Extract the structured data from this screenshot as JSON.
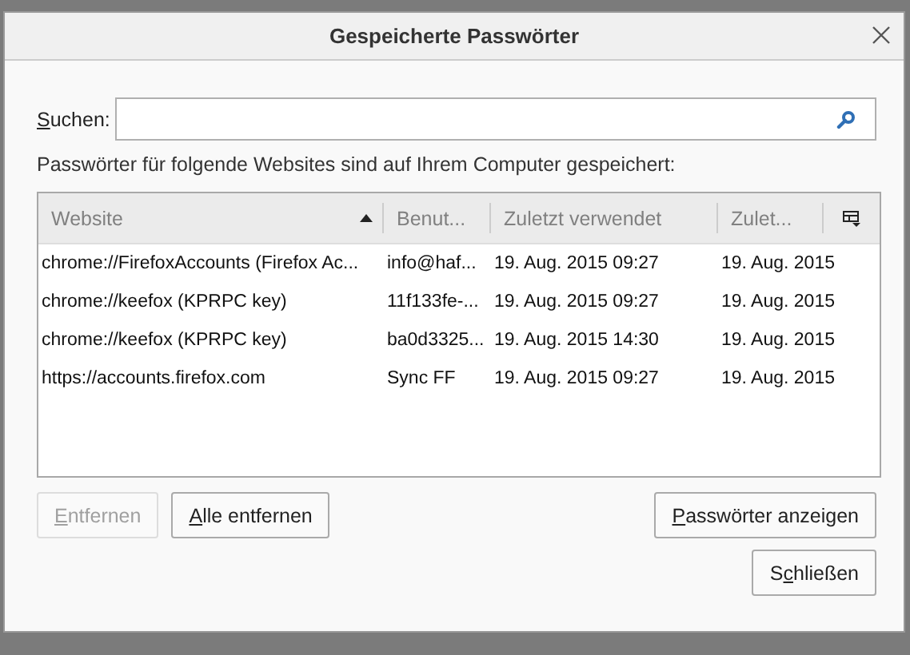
{
  "window": {
    "title": "Gespeicherte Passwörter"
  },
  "search": {
    "label": {
      "key": "S",
      "after": "uchen:"
    }
  },
  "description": "Passwörter für folgende Websites sind auf Ihrem Computer gespeichert:",
  "table": {
    "columns": [
      {
        "label": "Website",
        "sorted": true
      },
      {
        "label": "Benut...",
        "sorted": false
      },
      {
        "label": "Zuletzt verwendet",
        "sorted": false
      },
      {
        "label": "Zulet...",
        "sorted": false
      }
    ],
    "rows": [
      [
        "chrome://FirefoxAccounts (Firefox Ac...",
        "info@haf...",
        "19. Aug. 2015 09:27",
        "19. Aug. 2015"
      ],
      [
        "chrome://keefox (KPRPC key)",
        "11f133fe-...",
        "19. Aug. 2015 09:27",
        "19. Aug. 2015"
      ],
      [
        "chrome://keefox (KPRPC key)",
        "ba0d3325...",
        "19. Aug. 2015 14:30",
        "19. Aug. 2015"
      ],
      [
        "https://accounts.firefox.com",
        "Sync FF",
        "19. Aug. 2015 09:27",
        "19. Aug. 2015"
      ]
    ]
  },
  "buttons": [
    {
      "label": {
        "key": "E",
        "after": "ntfernen"
      },
      "disabled": true
    },
    {
      "label": {
        "key": "A",
        "after": "lle entfernen"
      },
      "disabled": false
    },
    {
      "label": {
        "key": "P",
        "after": "asswörter anzeigen"
      },
      "disabled": false
    },
    {
      "label": {
        "before": "S",
        "key": "c",
        "after": "hließen"
      },
      "disabled": false
    }
  ]
}
